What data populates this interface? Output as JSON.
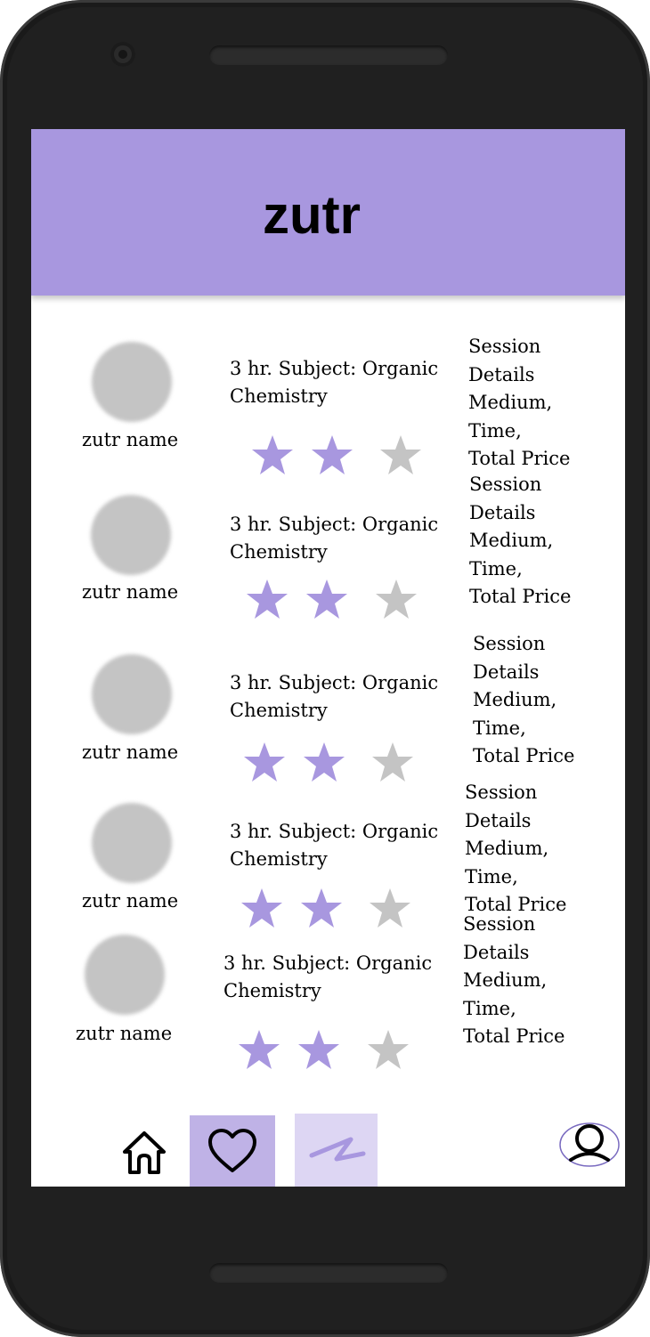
{
  "app": {
    "title": "zutr"
  },
  "colors": {
    "accent": "#a897df",
    "star_filled": "#a897df",
    "star_empty": "#c4c4c4",
    "nav_active": "#bfb2e6",
    "nav_secondary": "#ddd6f3"
  },
  "sessions": [
    {
      "tutor_name": "zutr name",
      "subject_line1": "3 hr. Subject: Organic",
      "subject_line2": "Chemistry",
      "rating": 2,
      "rating_max": 3,
      "details": [
        "Session",
        "Details",
        "Medium,",
        "Time,",
        "Total Price"
      ]
    },
    {
      "tutor_name": "zutr name",
      "subject_line1": "3 hr. Subject: Organic",
      "subject_line2": "Chemistry",
      "rating": 2,
      "rating_max": 3,
      "details": [
        "Session",
        "Details",
        "Medium,",
        "Time,",
        "Total Price"
      ]
    },
    {
      "tutor_name": "zutr name",
      "subject_line1": "3 hr. Subject: Organic",
      "subject_line2": "Chemistry",
      "rating": 2,
      "rating_max": 3,
      "details": [
        "Session",
        "Details",
        "Medium,",
        "Time,",
        "Total Price"
      ]
    },
    {
      "tutor_name": "zutr name",
      "subject_line1": "3 hr. Subject: Organic",
      "subject_line2": "Chemistry",
      "rating": 2,
      "rating_max": 3,
      "details": [
        "Session",
        "Details",
        "Medium,",
        "Time,",
        "Total Price"
      ]
    },
    {
      "tutor_name": "zutr name",
      "subject_line1": "3 hr. Subject: Organic",
      "subject_line2": "Chemistry",
      "rating": 2,
      "rating_max": 3,
      "details": [
        "Session",
        "Details",
        "Medium,",
        "Time,",
        "Total Price"
      ]
    }
  ],
  "bottom_nav": [
    {
      "icon": "home-icon",
      "active": false
    },
    {
      "icon": "heart-icon",
      "active": true
    },
    {
      "icon": "zutr-logo-icon",
      "active": false
    },
    {
      "icon": "profile-icon",
      "active": false
    }
  ]
}
